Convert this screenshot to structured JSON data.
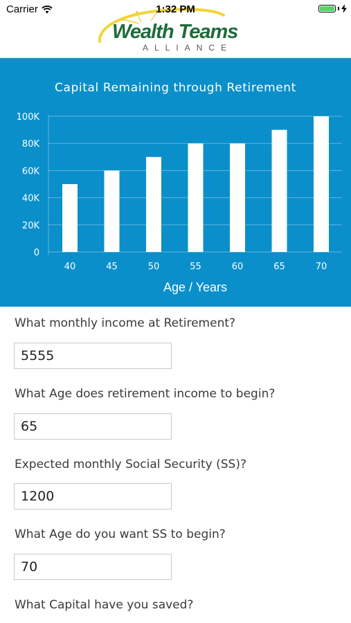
{
  "status_bar": {
    "carrier": "Carrier",
    "time": "1:32 PM"
  },
  "header": {
    "logo_main": "Wealth Teams",
    "logo_sub": "ALLIANCE",
    "colors": {
      "logo_green": "#1f6b3a",
      "swoosh_yellow": "#f2d43a"
    }
  },
  "chart_panel": {
    "background": "#0b8fcb"
  },
  "chart_data": {
    "type": "bar",
    "title": "Capital Remaining through Retirement",
    "xlabel": "Age / Years",
    "ylabel": "",
    "categories": [
      "40",
      "45",
      "50",
      "55",
      "60",
      "65",
      "70"
    ],
    "values": [
      50000,
      60000,
      70000,
      80000,
      80000,
      90000,
      100000
    ],
    "yticks": [
      "0",
      "20K",
      "40K",
      "60K",
      "80K",
      "100K"
    ],
    "ylim": [
      0,
      100000
    ],
    "grid": true,
    "bar_color": "#ffffff"
  },
  "form": {
    "questions": [
      {
        "label": "What monthly income at Retirement?",
        "value": "5555"
      },
      {
        "label": "What Age does retirement income to begin?",
        "value": "65"
      },
      {
        "label": "Expected monthly Social Security (SS)?",
        "value": "1200"
      },
      {
        "label": "What Age do you want SS to begin?",
        "value": "70"
      },
      {
        "label": "What Capital have you saved?"
      }
    ]
  }
}
